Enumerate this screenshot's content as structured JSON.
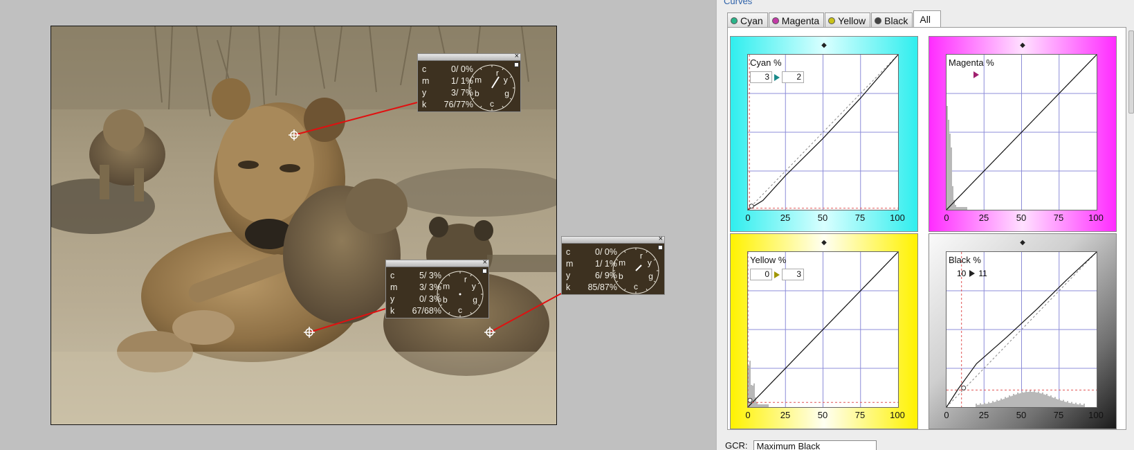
{
  "panel": {
    "title": "Curves",
    "tabs": [
      {
        "label": "Cyan",
        "color": "#2bb48a"
      },
      {
        "label": "Magenta",
        "color": "#c23aa6"
      },
      {
        "label": "Yellow",
        "color": "#c9c21a"
      },
      {
        "label": "Black",
        "color": "#444444"
      },
      {
        "label": "All",
        "active": true
      }
    ],
    "gcr_label": "GCR:",
    "gcr_value": "Maximum Black"
  },
  "curves": [
    {
      "id": "cyan",
      "label": "Cyan %",
      "in": "3",
      "out": "2",
      "bg": [
        "#40f0f0",
        "#e6ffff"
      ]
    },
    {
      "id": "magenta",
      "label": "Magenta %",
      "in": "",
      "out": "",
      "bg": [
        "#ff30ff",
        "#ffe6ff"
      ]
    },
    {
      "id": "yellow",
      "label": "Yellow %",
      "in": "0",
      "out": "3",
      "bg": [
        "#fff400",
        "#fffff0"
      ]
    },
    {
      "id": "black",
      "label": "Black %",
      "in": "10",
      "out": "11",
      "bg": [
        "#ffffff",
        "#111111"
      ]
    }
  ],
  "axis_ticks": [
    "0",
    "25",
    "50",
    "75",
    "100"
  ],
  "readouts": [
    {
      "id": "r1",
      "rows": [
        [
          "c",
          "0/ 0%"
        ],
        [
          "m",
          "1/ 1%"
        ],
        [
          "y",
          "3/ 7%"
        ],
        [
          "k",
          "76/77%"
        ]
      ]
    },
    {
      "id": "r2",
      "rows": [
        [
          "c",
          "5/ 3%"
        ],
        [
          "m",
          "3/ 3%"
        ],
        [
          "y",
          "0/ 3%"
        ],
        [
          "k",
          "67/68%"
        ]
      ]
    },
    {
      "id": "r3",
      "rows": [
        [
          "c",
          "0/ 0%"
        ],
        [
          "m",
          "1/ 1%"
        ],
        [
          "y",
          "6/ 9%"
        ],
        [
          "k",
          "85/87%"
        ]
      ]
    }
  ],
  "dial_letters": [
    "r",
    "y",
    "g",
    "c",
    "b",
    "m"
  ],
  "close_glyph": "×"
}
